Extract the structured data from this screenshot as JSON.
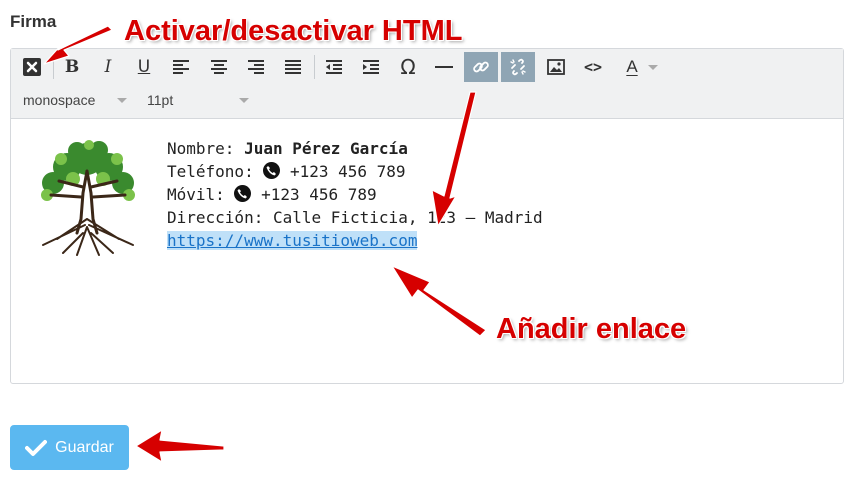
{
  "field": {
    "label": "Firma"
  },
  "toolbar": {
    "font_family": "monospace",
    "font_size": "11pt",
    "bold_glyph": "B",
    "italic_glyph": "I",
    "underline_glyph": "U",
    "omega_glyph": "Ω",
    "code_glyph": "<>",
    "color_glyph": "A"
  },
  "signature": {
    "name_label": "Nombre: ",
    "name_value": "Juan Pérez García",
    "phone_label": "Teléfono: ",
    "phone_value": " +123 456 789",
    "mobile_label": "Móvil: ",
    "mobile_value": " +123 456 789",
    "address": "Dirección: Calle Ficticia, 123 — Madrid",
    "website": "https://www.tusitioweb.com"
  },
  "annotations": {
    "html_toggle": "Activar/desactivar HTML",
    "add_link": "Añadir enlace"
  },
  "save": {
    "label": "Guardar"
  },
  "colors": {
    "annotation": "#d60000",
    "save_button": "#5bb8f0",
    "active_tool": "#8fa5b4",
    "link": "#1a73c8"
  }
}
